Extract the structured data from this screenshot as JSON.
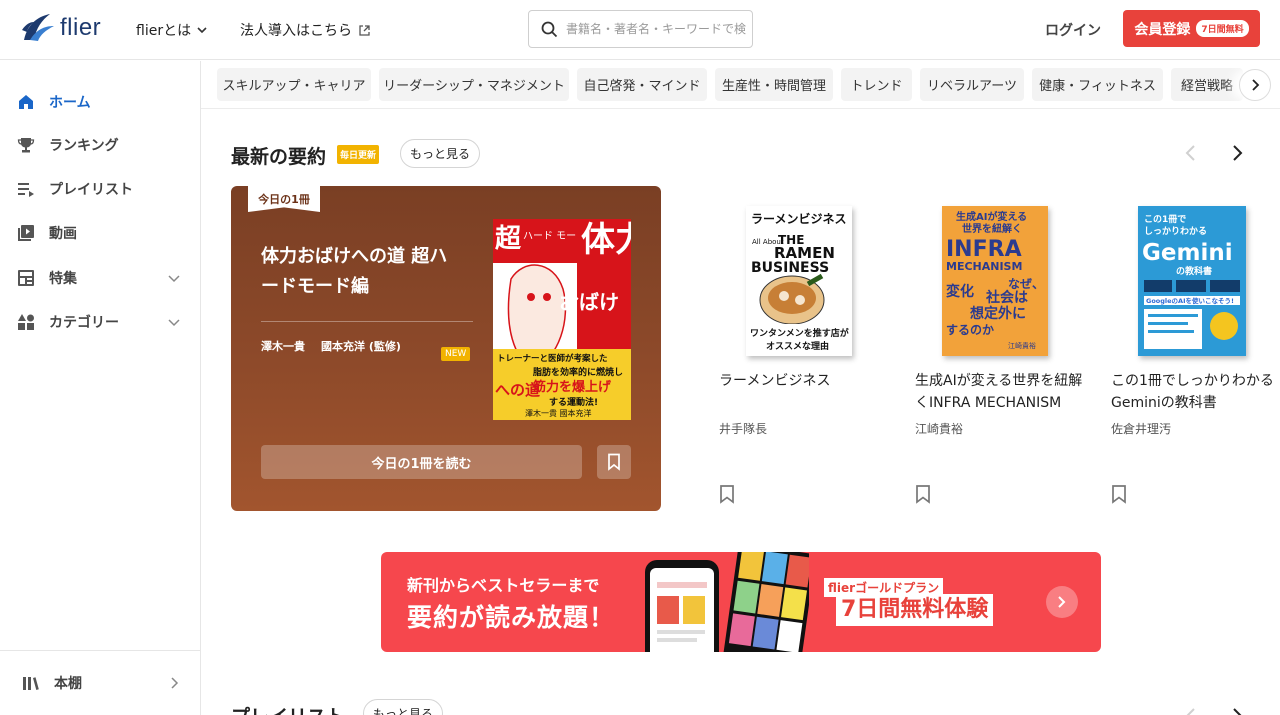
{
  "header": {
    "logo_text": "flier",
    "about_label": "flierとは",
    "corporate_label": "法人導入はこちら",
    "search_placeholder": "書籍名・著者名・キーワードで検索",
    "login_label": "ログイン",
    "signup_label": "会員登録",
    "signup_badge": "7日間無料"
  },
  "sidebar": {
    "items": [
      {
        "label": "ホーム",
        "icon": "home-icon",
        "active": true
      },
      {
        "label": "ランキング",
        "icon": "trophy-icon"
      },
      {
        "label": "プレイリスト",
        "icon": "playlist-icon"
      },
      {
        "label": "動画",
        "icon": "video-icon"
      },
      {
        "label": "特集",
        "icon": "feature-icon",
        "expandable": true
      },
      {
        "label": "カテゴリー",
        "icon": "category-icon",
        "expandable": true
      }
    ],
    "bookshelf_label": "本棚"
  },
  "categories": [
    "スキルアップ・キャリア",
    "リーダーシップ・マネジメント",
    "自己啓発・マインド",
    "生産性・時間管理",
    "トレンド",
    "リベラルアーツ",
    "健康・フィットネス",
    "経営戦略"
  ],
  "latest": {
    "title": "最新の要約",
    "badge": "毎日更新",
    "more_label": "もっと見る",
    "featured": {
      "tag": "今日の1冊",
      "title": "体力おばけへの道 超ハードモード編",
      "author1": "澤木一貴",
      "author2": "國本充洋 (監修)",
      "new_badge": "NEW",
      "read_label": "今日の1冊を読む",
      "cover": {
        "big_char": "超",
        "sub": "ハード モード 編",
        "vertical1": "体力",
        "vertical2": "おばけ",
        "vertical3": "への道",
        "tagline": "トレーナーと医師が考案した",
        "tagline2": "脂肪を効率的に燃焼し",
        "tagline3": "筋力を爆上げ",
        "tagline4": "する運動法!",
        "authors": "澤木一貴 國本充洋"
      }
    },
    "books": [
      {
        "title": "ラーメンビジネス",
        "author": "井手隊長",
        "cover": {
          "head": "ラーメンビジネス",
          "en1": "All About",
          "en2": "THE",
          "en3": "RAMEN",
          "en4": "BUSINESS",
          "foot1": "ワンタンメンを推す店が",
          "foot2": "オススメな理由"
        }
      },
      {
        "title": "生成AIが変える世界を紐解くINFRA MECHANISM",
        "author": "江崎貴裕",
        "cover": {
          "head1": "生成AIが変える",
          "head2": "世界を紐解く",
          "en1": "INFRA",
          "en2": "MECHANISM",
          "v1": "なぜ、",
          "v2": "社会は",
          "v3": "想定外に",
          "v4": "変化",
          "v5": "するのか",
          "foot": "江崎貴裕"
        }
      },
      {
        "title": "この1冊でしっかりわかるGeminiの教科書",
        "author": "佐倉井理汚",
        "cover": {
          "head1": "この1冊で",
          "head2": "しっかりわかる",
          "big": "Gemini",
          "sub": "の教科書",
          "tag": "GoogleのAIを使いこなそう!"
        }
      }
    ]
  },
  "banner": {
    "line1": "新刊からベストセラーまで",
    "line2": "要約が読み放題！",
    "plan": "flierゴールドプラン",
    "trial": "7日間無料体験"
  },
  "playlist_section": {
    "title": "プレイリスト",
    "more_label": "もっと見る"
  },
  "colors": {
    "accent_red": "#e8423b",
    "active_blue": "#1a66c8",
    "badge_yellow": "#f2b300",
    "feature_brown": "#8e4a2a"
  }
}
